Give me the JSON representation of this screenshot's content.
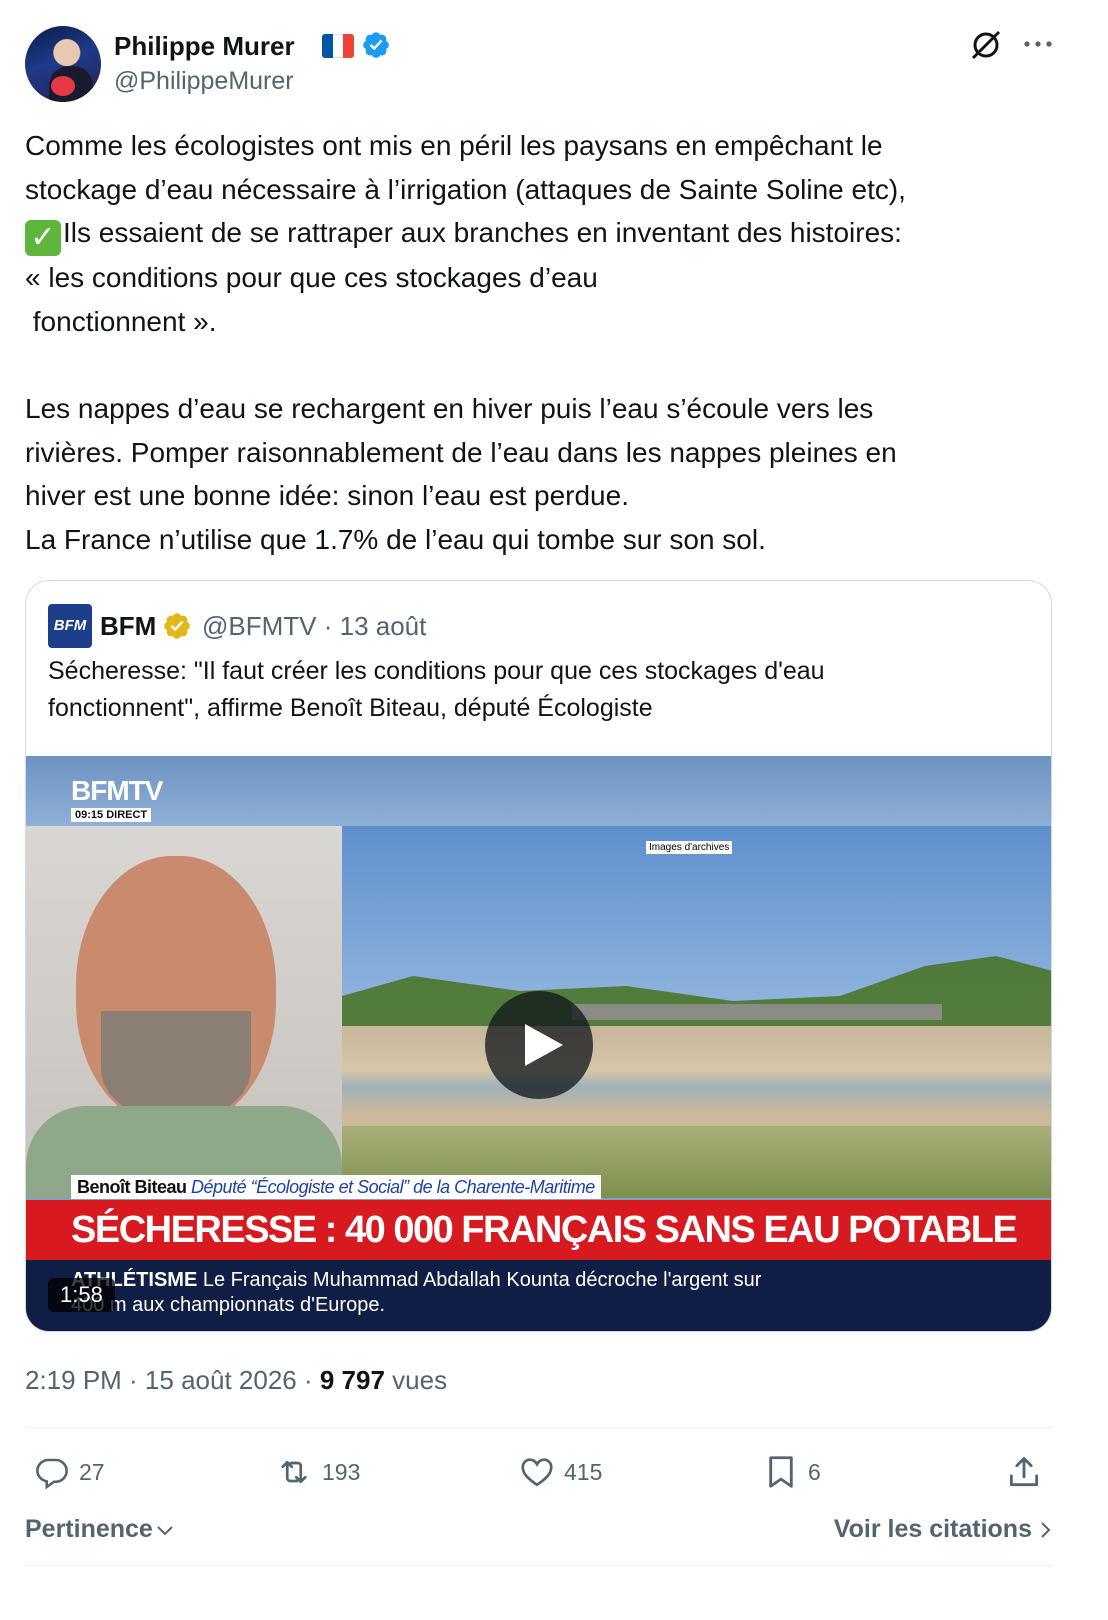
{
  "author": {
    "name": "Philippe Murer",
    "handle": "@PhilippeMurer",
    "flag_emoji": "🇫🇷",
    "verified_color": "#1d9bf0"
  },
  "tweet": {
    "line1": "Comme les écologistes ont mis en péril les paysans en empêchant le",
    "line2": "stockage d’eau nécessaire à l’irrigation (attaques de Sainte Soline etc),",
    "line3_emoji": "✅",
    "line3": "Ils essaient de se rattraper aux branches en inventant des histoires:",
    "line4": "« les conditions pour que ces stockages d’eau",
    "line5": " fonctionnent ».",
    "line7": "Les nappes d’eau se rechargent en hiver puis l’eau s’écoule vers les",
    "line8": "rivières. Pomper raisonnablement de l’eau dans les nappes pleines en",
    "line9": "hiver est une bonne idée: sinon l’eau est perdue.",
    "line10": "La France n’utilise que 1.7% de l’eau qui tombe sur son sol."
  },
  "quoted": {
    "logo_text": "BFM",
    "name": "BFM",
    "meta": "@BFMTV · 13 août",
    "gold_badge_color": "#e2b719",
    "text_line1": "Sécheresse: \"Il faut créer les conditions pour que ces stockages d'eau",
    "text_line2": "fonctionnent\", affirme Benoît Biteau, député Écologiste",
    "video": {
      "channel": "BFMTV",
      "clock": "09:15  DIRECT",
      "archive_label": "Images d'archives",
      "speaker_name": "Benoît Biteau",
      "speaker_role": "Député “Écologiste et Social” de la Charente-Maritime",
      "headline": "SÉCHERESSE : 40 000 FRANÇAIS SANS EAU POTABLE",
      "ticker_tag": "ATHLÉTISME",
      "ticker_line1": " Le Français Muhammad Abdallah Kounta décroche l'argent sur",
      "ticker_line2": "400 m aux championnats d'Europe.",
      "duration": "1:58"
    }
  },
  "meta": {
    "time": "2:19 PM · 15 août 2026 · ",
    "views_count": "9 797",
    "views_label": " vues"
  },
  "actions": {
    "replies": "27",
    "reposts": "193",
    "likes": "415",
    "bookmarks": "6"
  },
  "footer": {
    "sort_label": "Pertinence",
    "quotes_link": "Voir les citations"
  }
}
